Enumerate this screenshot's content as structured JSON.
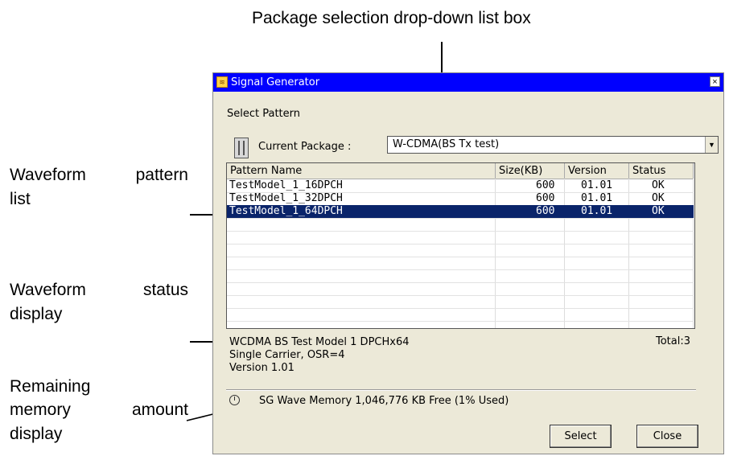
{
  "annotations": {
    "package_dropdown": "Package selection drop-down list box",
    "pattern_list": [
      "Waveform pattern",
      "list"
    ],
    "status_display": [
      "Waveform status",
      "display"
    ],
    "remaining_memory": [
      "Remaining",
      "memory amount",
      "display"
    ]
  },
  "dialog": {
    "title": "Signal Generator",
    "close_glyph": "×",
    "section_label": "Select Pattern",
    "current_package_label": "Current Package :",
    "current_package_value": "W-CDMA(BS Tx test)",
    "columns": [
      "Pattern Name",
      "Size(KB)",
      "Version",
      "Status"
    ],
    "rows": [
      {
        "name": "TestModel_1_16DPCH",
        "size": "600",
        "version": "01.01",
        "status": "OK"
      },
      {
        "name": "TestModel_1_32DPCH",
        "size": "600",
        "version": "01.01",
        "status": "OK"
      },
      {
        "name": "TestModel_1_64DPCH",
        "size": "600",
        "version": "01.01",
        "status": "OK"
      }
    ],
    "selected_row": 2,
    "status_lines": [
      "WCDMA BS Test Model 1 DPCHx64",
      "Single Carrier, OSR=4",
      "Version 1.01"
    ],
    "total": "Total:3",
    "memory_text": "SG Wave Memory 1,046,776 KB Free (1% Used)",
    "select_button": "Select",
    "close_button": "Close"
  },
  "colors": {
    "titlebar": "#0000ff",
    "selection": "#0a246a",
    "dialog_bg": "#ece9d8"
  }
}
